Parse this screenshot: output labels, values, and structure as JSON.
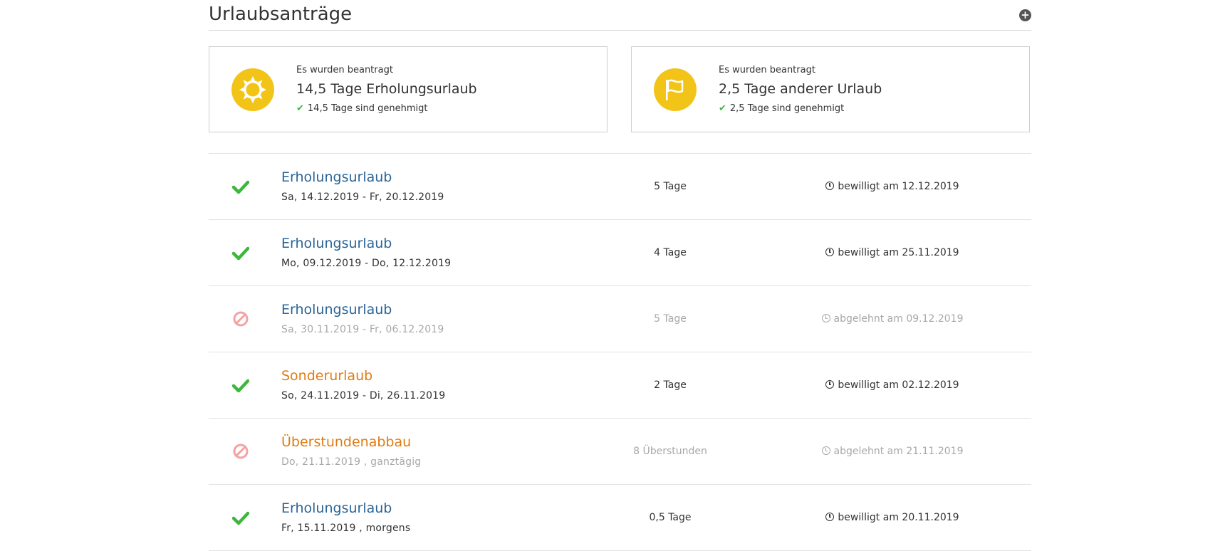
{
  "header": {
    "title": "Urlaubsanträge",
    "add_icon": "plus-circle-icon"
  },
  "summary": [
    {
      "icon": "sun-icon",
      "subtitle": "Es wurden beantragt",
      "main": "14,5 Tage Erholungsurlaub",
      "approved": "14,5 Tage sind genehmigt"
    },
    {
      "icon": "flag-icon",
      "subtitle": "Es wurden beantragt",
      "main": "2,5 Tage anderer Urlaub",
      "approved": "2,5 Tage sind genehmigt"
    }
  ],
  "requests": [
    {
      "status": "approved",
      "type": "Erholungsurlaub",
      "dates": "Sa, 14.12.2019 - Fr, 20.12.2019",
      "amount": "5 Tage",
      "decision": "bewilligt am 12.12.2019"
    },
    {
      "status": "approved",
      "type": "Erholungsurlaub",
      "dates": "Mo, 09.12.2019 - Do, 12.12.2019",
      "amount": "4 Tage",
      "decision": "bewilligt am 25.11.2019"
    },
    {
      "status": "rejected",
      "type": "Erholungsurlaub",
      "dates": "Sa, 30.11.2019 - Fr, 06.12.2019",
      "amount": "5 Tage",
      "decision": "abgelehnt am 09.12.2019"
    },
    {
      "status": "approved",
      "type": "Sonderurlaub",
      "dates": "So, 24.11.2019 - Di, 26.11.2019",
      "amount": "2 Tage",
      "decision": "bewilligt am 02.12.2019"
    },
    {
      "status": "rejected",
      "type": "Überstundenabbau",
      "dates": "Do, 21.11.2019 , ganztägig",
      "amount": "8 Überstunden",
      "decision": "abgelehnt am 21.11.2019"
    },
    {
      "status": "approved",
      "type": "Erholungsurlaub",
      "dates": "Fr, 15.11.2019 , morgens",
      "amount": "0,5 Tage",
      "decision": "bewilligt am 20.11.2019"
    }
  ],
  "colors": {
    "accent_yellow": "#f2c417",
    "link_blue": "#2a6496",
    "special_orange": "#e07b12",
    "approved_green": "#3cb73c",
    "rejected_red": "#f4a3a3"
  }
}
